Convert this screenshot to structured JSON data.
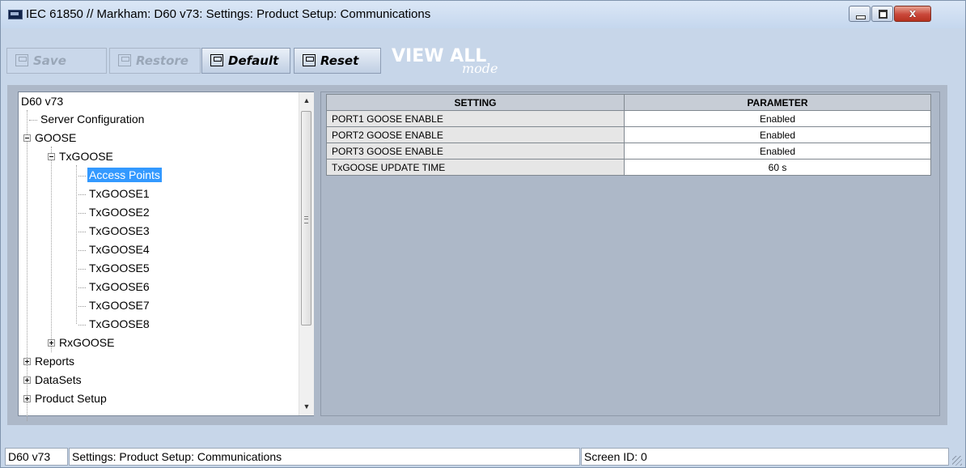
{
  "window": {
    "title": "IEC 61850 // Markham: D60 v73: Settings: Product Setup: Communications",
    "buttons": {
      "minimize": "",
      "maximize": "",
      "close": "x"
    }
  },
  "toolbar": {
    "save": "Save",
    "restore": "Restore",
    "default": "Default",
    "reset": "Reset",
    "view_all_main": "VIEW ALL",
    "view_all_mode": "mode"
  },
  "tree": {
    "root": "D60 v73",
    "items": {
      "server_configuration": "Server Configuration",
      "goose": "GOOSE",
      "txgoose": "TxGOOSE",
      "access_points": "Access Points",
      "txgoose1": "TxGOOSE1",
      "txgoose2": "TxGOOSE2",
      "txgoose3": "TxGOOSE3",
      "txgoose4": "TxGOOSE4",
      "txgoose5": "TxGOOSE5",
      "txgoose6": "TxGOOSE6",
      "txgoose7": "TxGOOSE7",
      "txgoose8": "TxGOOSE8",
      "rxgoose": "RxGOOSE",
      "reports": "Reports",
      "datasets": "DataSets",
      "product_setup": "Product Setup"
    }
  },
  "grid": {
    "headers": {
      "setting": "SETTING",
      "parameter": "PARAMETER"
    },
    "rows": [
      {
        "setting": "PORT1 GOOSE ENABLE",
        "parameter": "Enabled"
      },
      {
        "setting": "PORT2 GOOSE ENABLE",
        "parameter": "Enabled"
      },
      {
        "setting": "PORT3 GOOSE ENABLE",
        "parameter": "Enabled"
      },
      {
        "setting": "TxGOOSE UPDATE TIME",
        "parameter": "60 s"
      }
    ]
  },
  "status": {
    "device": "D60 v73",
    "path": "Settings: Product Setup: Communications",
    "screen_id": "Screen ID: 0"
  },
  "colors": {
    "window_bg": "#c7d6e9",
    "panel_bg": "#adb8c8",
    "selection": "#3399ff",
    "close_button": "#c9473a"
  },
  "icons": [
    "app-icon",
    "save-icon",
    "restore-icon",
    "default-icon",
    "reset-icon",
    "minimize-icon",
    "maximize-icon",
    "close-icon",
    "expand-icon",
    "collapse-icon",
    "scroll-up-icon",
    "scroll-down-icon"
  ]
}
